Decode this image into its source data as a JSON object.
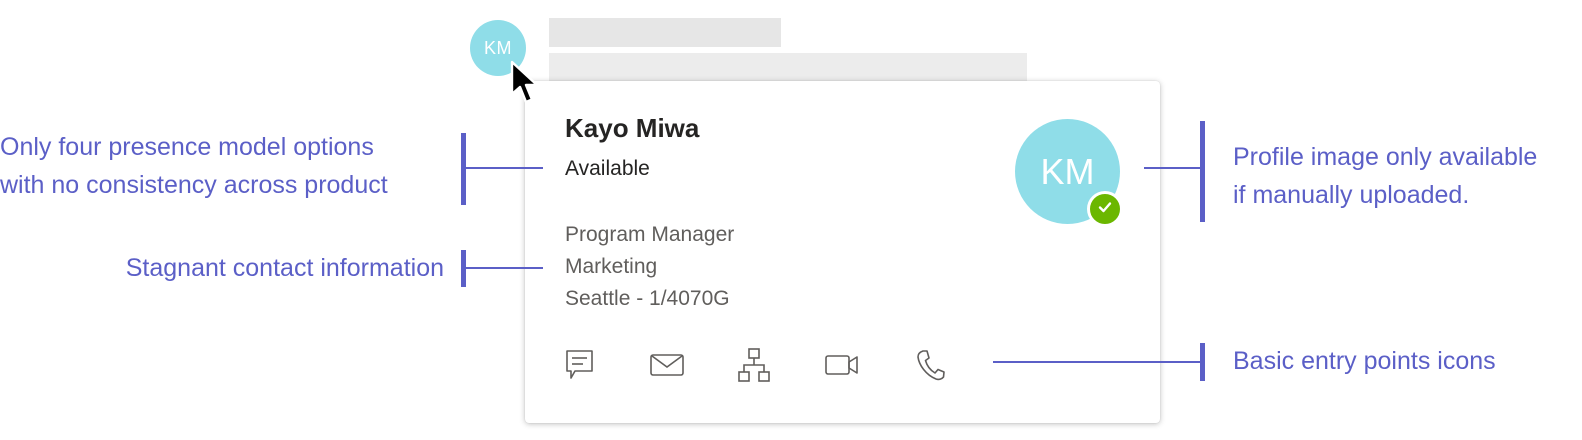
{
  "background_avatar": {
    "initials": "KM"
  },
  "profile_card": {
    "name": "Kayo Miwa",
    "presence": "Available",
    "contact": {
      "title": "Program Manager",
      "department": "Marketing",
      "location": "Seattle - 1/4070G"
    },
    "avatar_initials": "KM",
    "presence_badge_icon": "checkmark-icon",
    "actions": [
      {
        "icon": "chat-icon"
      },
      {
        "icon": "mail-icon"
      },
      {
        "icon": "org-chart-icon"
      },
      {
        "icon": "video-call-icon"
      },
      {
        "icon": "phone-call-icon"
      }
    ]
  },
  "annotations": {
    "presence_line1": "Only four presence model options",
    "presence_line2": "with no consistency across product",
    "contact": "Stagnant contact information",
    "profile_line1": "Profile image only available",
    "profile_line2": "if manually uploaded.",
    "entry_points": "Basic entry points icons"
  },
  "colors": {
    "annotation": "#5b5fc7",
    "avatar": "#8fdde8",
    "presence_available": "#6bb700",
    "placeholder": "#e6e6e6"
  }
}
